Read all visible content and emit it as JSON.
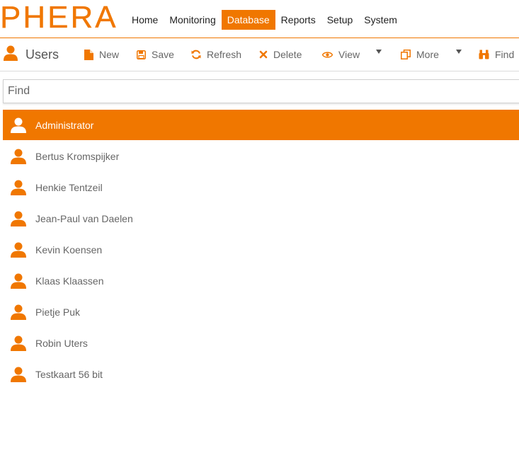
{
  "app": {
    "logo_text": "PHERA"
  },
  "topnav": [
    {
      "label": "Home",
      "active": false
    },
    {
      "label": "Monitoring",
      "active": false
    },
    {
      "label": "Database",
      "active": true
    },
    {
      "label": "Reports",
      "active": false
    },
    {
      "label": "Setup",
      "active": false
    },
    {
      "label": "System",
      "active": false
    }
  ],
  "page": {
    "title": "Users"
  },
  "toolbar": {
    "new_label": "New",
    "save_label": "Save",
    "refresh_label": "Refresh",
    "delete_label": "Delete",
    "view_label": "View",
    "more_label": "More",
    "find_label": "Find"
  },
  "search": {
    "placeholder": "Find",
    "value": ""
  },
  "users": [
    {
      "name": "Administrator",
      "selected": true
    },
    {
      "name": "Bertus Kromspijker",
      "selected": false
    },
    {
      "name": "Henkie Tentzeil",
      "selected": false
    },
    {
      "name": "Jean-Paul van Daelen",
      "selected": false
    },
    {
      "name": "Kevin Koensen",
      "selected": false
    },
    {
      "name": "Klaas Klaassen",
      "selected": false
    },
    {
      "name": "Pietje Puk",
      "selected": false
    },
    {
      "name": "Robin Uters",
      "selected": false
    },
    {
      "name": "Testkaart 56 bit",
      "selected": false
    }
  ],
  "colors": {
    "accent": "#f07700",
    "text": "#666666",
    "selected_text": "#ffffff"
  },
  "icons": {
    "page_title": "user-icon",
    "new": "file-icon",
    "save": "floppy-icon",
    "refresh": "refresh-icon",
    "delete": "x-icon",
    "view": "eye-icon",
    "more": "copy-icon",
    "find": "binoculars-icon",
    "user_row": "user-icon"
  }
}
